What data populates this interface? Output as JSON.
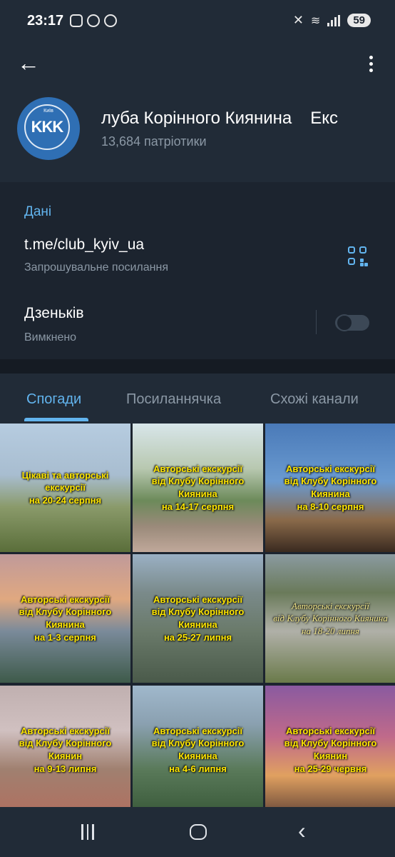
{
  "status": {
    "time": "23:17",
    "battery": "59"
  },
  "channel": {
    "avatar_top": "Київ",
    "avatar_text": "KKK",
    "title": "луба Корінного Киянина",
    "title_extra": "Екс",
    "subscribers": "13,684 патріотики"
  },
  "info": {
    "section_title": "Дані",
    "link": "t.me/club_kyiv_ua",
    "link_sub": "Запрошувальне посилання",
    "dz_label": "Дзеньків",
    "dz_sub": "Вимкнено"
  },
  "tabs": [
    {
      "label": "Спогади",
      "active": true
    },
    {
      "label": "Посиланнячка",
      "active": false
    },
    {
      "label": "Схожі канали",
      "active": false
    }
  ],
  "media": [
    {
      "text": "Цікаві та авторські екскурсії\nна 20-24 серпня"
    },
    {
      "text": "Авторські екскурсії\nвід Клубу Корінного Киянина\nна 14-17 серпня"
    },
    {
      "text": "Авторські екскурсії\nвід Клубу Корінного Киянина\nна 8-10 серпня"
    },
    {
      "text": "Авторські екскурсії\nвід Клубу Корінного Киянина\nна 1-3 серпня"
    },
    {
      "text": "Авторські екскурсії\nвід Клубу Корінного Киянина\nна 25-27 липня"
    },
    {
      "text": "Авторські екскурсії\nвід Клубу Корінного Киянина\nна 18-20 липня"
    },
    {
      "text": "Авторські екскурсії\nвід Клубу Корінного Киянин\nна 9-13 липня"
    },
    {
      "text": "Авторські екскурсії\nвід Клубу Корінного Киянина\nна 4-6 липня"
    },
    {
      "text": "Авторські екскурсії\nвід Клубу Корінного Киянин\nна 25-29 червня"
    }
  ],
  "icons": [
    "back-arrow-icon",
    "more-vert-icon",
    "qr-code-icon",
    "mute-icon",
    "wifi-icon",
    "signal-icon"
  ],
  "colors": {
    "accent": "#62b4ee",
    "header_bg": "#212b37",
    "bg": "#1c242f",
    "label_yellow": "#ffe600"
  }
}
